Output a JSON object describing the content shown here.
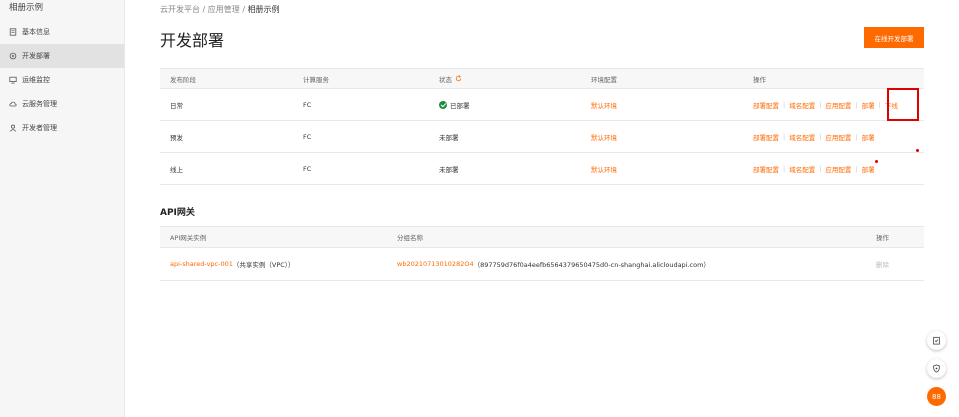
{
  "sidebar": {
    "app_name": "相册示例",
    "items": [
      {
        "label": "基本信息",
        "icon": "info-doc-icon"
      },
      {
        "label": "开发部署",
        "icon": "deploy-gear-icon",
        "active": true
      },
      {
        "label": "运维监控",
        "icon": "monitor-icon"
      },
      {
        "label": "云服务管理",
        "icon": "cloud-service-icon"
      },
      {
        "label": "开发者管理",
        "icon": "user-icon"
      }
    ]
  },
  "breadcrumb": {
    "part1": "云开发平台",
    "sep": " / ",
    "part2": "应用管理",
    "part3": "相册示例"
  },
  "page": {
    "title": "开发部署",
    "online_deploy_button": "在线开发部署"
  },
  "deploy_table": {
    "headers": [
      "发布阶段",
      "计算服务",
      "状态",
      "环境配置",
      "操作"
    ],
    "rows": [
      {
        "stage": "日常",
        "compute": "FC",
        "status": "已部署",
        "deployed": true,
        "env": "默认环境",
        "actions": [
          "部署配置",
          "域名配置",
          "应用配置",
          "部署",
          "下线"
        ]
      },
      {
        "stage": "预发",
        "compute": "FC",
        "status": "未部署",
        "deployed": false,
        "env": "默认环境",
        "actions": [
          "部署配置",
          "域名配置",
          "应用配置",
          "部署"
        ]
      },
      {
        "stage": "线上",
        "compute": "FC",
        "status": "未部署",
        "deployed": false,
        "env": "默认环境",
        "actions": [
          "部署配置",
          "域名配置",
          "应用配置",
          "部署"
        ]
      }
    ]
  },
  "api_gateway": {
    "title": "API网关",
    "headers": [
      "API网关实例",
      "分组名称",
      "操作"
    ],
    "row": {
      "instance_link": "api-shared-vpc-001",
      "instance_suffix": "（共享实例（VPC））",
      "group_link": "wb20210713010282O4",
      "group_suffix": "（897759d76f0a4eefb6564379650475d0-cn-shanghai.alicloudapi.com）",
      "action": "删除"
    }
  },
  "floating": {
    "help_icon": "clipboard-icon",
    "security_icon": "shield-icon",
    "badge": "88"
  },
  "colors": {
    "accent": "#ff6a00",
    "success": "#1e8e3e",
    "highlight": "#e00000"
  }
}
